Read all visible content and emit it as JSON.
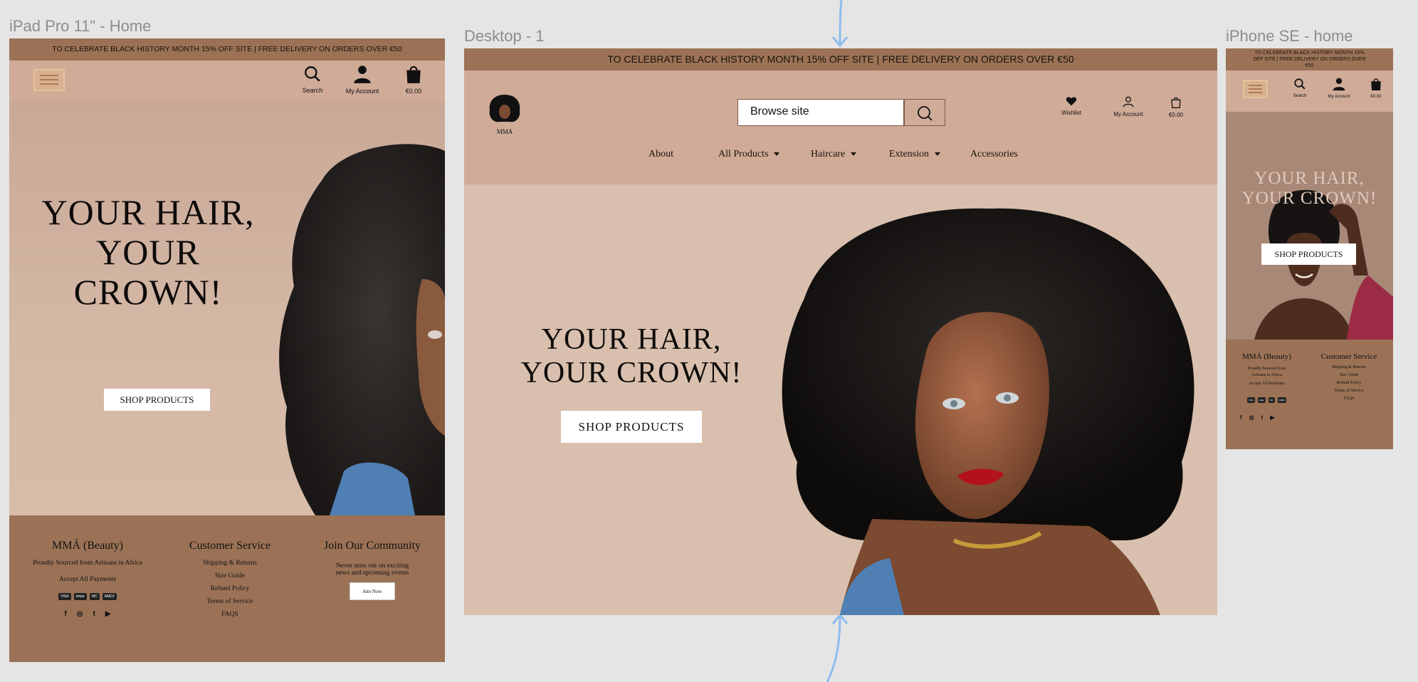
{
  "canvas": {
    "frames": {
      "ipad": "iPad Pro 11\" - Home",
      "desktop": "Desktop - 1",
      "iphone": "iPhone SE - home"
    }
  },
  "banner": "TO CELEBRATE BLACK HISTORY MONTH 15% OFF SITE | FREE DELIVERY ON ORDERS OVER €50",
  "iphone_banner": {
    "line1": "TO CELEBRATE BLACK HISTORY MONTH 15%",
    "line2": "OFF SITE | FREE DELIVERY ON ORDERS OVER",
    "line3": "€50"
  },
  "logo": {
    "text": "MMA"
  },
  "header": {
    "search_label": "Search",
    "account_label": "My Account",
    "cart_total": "€0.00",
    "wishlist_label": "Wishlist",
    "search_placeholder": "Browse site"
  },
  "nav": {
    "about": "About",
    "all_products": "All Products",
    "haircare": "Haircare",
    "extension": "Extension",
    "accessories": "Accessories"
  },
  "hero": {
    "line1": "YOUR HAIR,",
    "line2": "YOUR",
    "line3": "CROWN!",
    "desktop_line2": "YOUR CROWN!",
    "cta": "SHOP PRODUCTS"
  },
  "footer": {
    "brand_title": "MMÁ (Beauty)",
    "sourced": "Proudly Sourced from Artisans in Africa",
    "sourced_a": "Proudly Sourced from",
    "sourced_b": "Artisans in Africa",
    "payments_label": "Accept All Payments",
    "payment_methods": [
      "VISA",
      "stripe",
      "MC",
      "AMEX"
    ],
    "social": [
      "f",
      "◎",
      "t",
      "▶"
    ],
    "service_title": "Customer Service",
    "service_links": [
      "Shipping & Returns",
      "Size Guide",
      "Refund Policy",
      "Terms of Service",
      "FAQS"
    ],
    "community_title": "Join Our Community",
    "community_line1": "Never miss out on exciting",
    "community_line2": "news and upcoming events",
    "join_button": "Join Now"
  },
  "colors": {
    "canvas": "#e5e5e5",
    "banner": "#9b7256",
    "header": "#cfab98",
    "hero": "#d9bfad",
    "footer": "#9b7256",
    "hair": "#121010"
  },
  "icons": {
    "menu": "hamburger-icon",
    "search": "search-icon",
    "account": "user-icon",
    "cart": "shopping-bag-icon",
    "wishlist": "heart-icon"
  }
}
